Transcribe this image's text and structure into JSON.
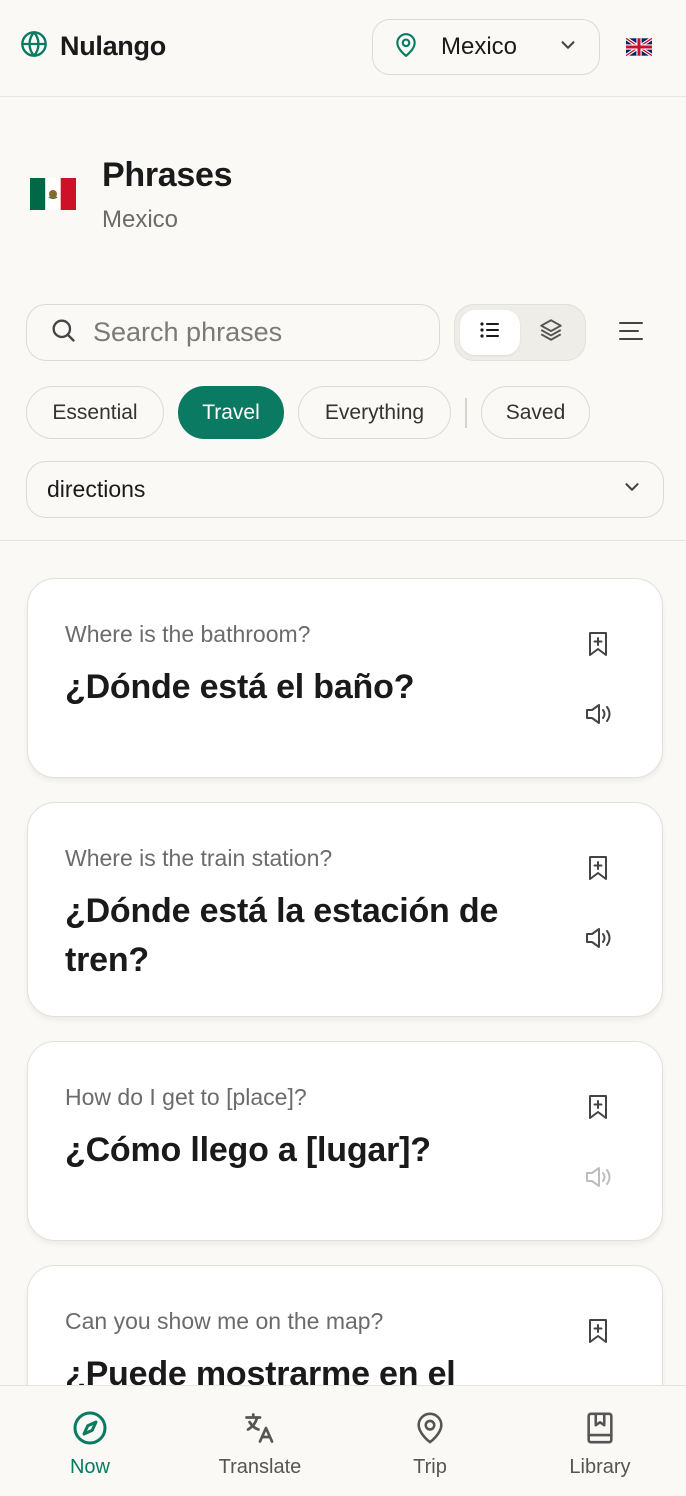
{
  "app": {
    "name": "Nulango"
  },
  "location": {
    "selected": "Mexico"
  },
  "header": {
    "title": "Phrases",
    "subtitle": "Mexico"
  },
  "search": {
    "placeholder": "Search phrases",
    "value": ""
  },
  "filters": {
    "chips": [
      {
        "label": "Essential",
        "active": false
      },
      {
        "label": "Travel",
        "active": true
      },
      {
        "label": "Everything",
        "active": false
      },
      {
        "label": "Saved",
        "active": false
      }
    ],
    "subcategory": "directions"
  },
  "phrases": [
    {
      "english": "Where is the bathroom?",
      "spanish": "¿Dónde está el baño?",
      "audio_available": true
    },
    {
      "english": "Where is the train station?",
      "spanish": "¿Dónde está la estación de tren?",
      "audio_available": true
    },
    {
      "english": "How do I get to [place]?",
      "spanish": "¿Cómo llego a [lugar]?",
      "audio_available": false
    },
    {
      "english": "Can you show me on the map?",
      "spanish": "¿Puede mostrarme en el",
      "audio_available": true
    }
  ],
  "nav": {
    "items": [
      {
        "label": "Now",
        "icon": "compass-icon",
        "active": true
      },
      {
        "label": "Translate",
        "icon": "translate-icon",
        "active": false
      },
      {
        "label": "Trip",
        "icon": "map-pin-icon",
        "active": false
      },
      {
        "label": "Library",
        "icon": "book-bookmark-icon",
        "active": false
      }
    ]
  },
  "colors": {
    "accent": "#0a7a62",
    "background": "#faf9f6",
    "card": "#ffffff",
    "muted_text": "#6b6b6b"
  }
}
